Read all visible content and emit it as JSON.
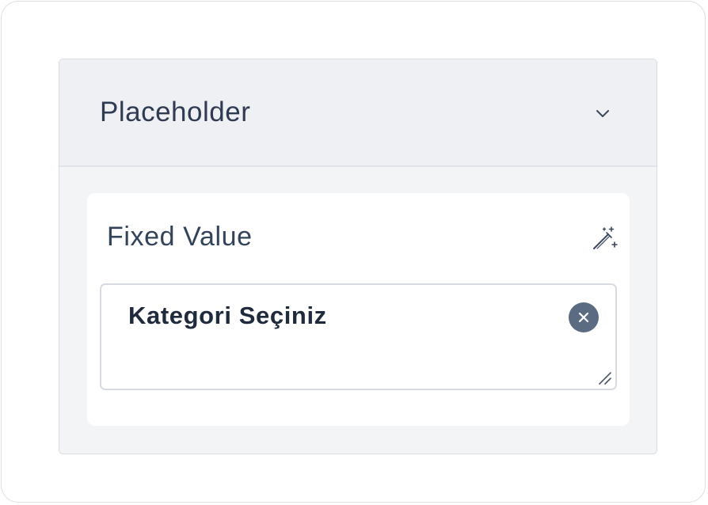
{
  "section": {
    "title": "Placeholder",
    "toggle_icon": "chevron-down-icon"
  },
  "fixed_value": {
    "label": "Fixed Value",
    "magic_icon": "magic-wand-icon",
    "input_value": "Kategori Seçiniz",
    "clear_icon": "clear-circle-icon",
    "resize_icon": "resize-handle-icon"
  },
  "colors": {
    "panel_background": "#f3f4f6",
    "header_background": "#eff0f3",
    "title_text": "#2e3b52",
    "clear_button": "#5b6b82",
    "border": "#d7dbe1"
  }
}
